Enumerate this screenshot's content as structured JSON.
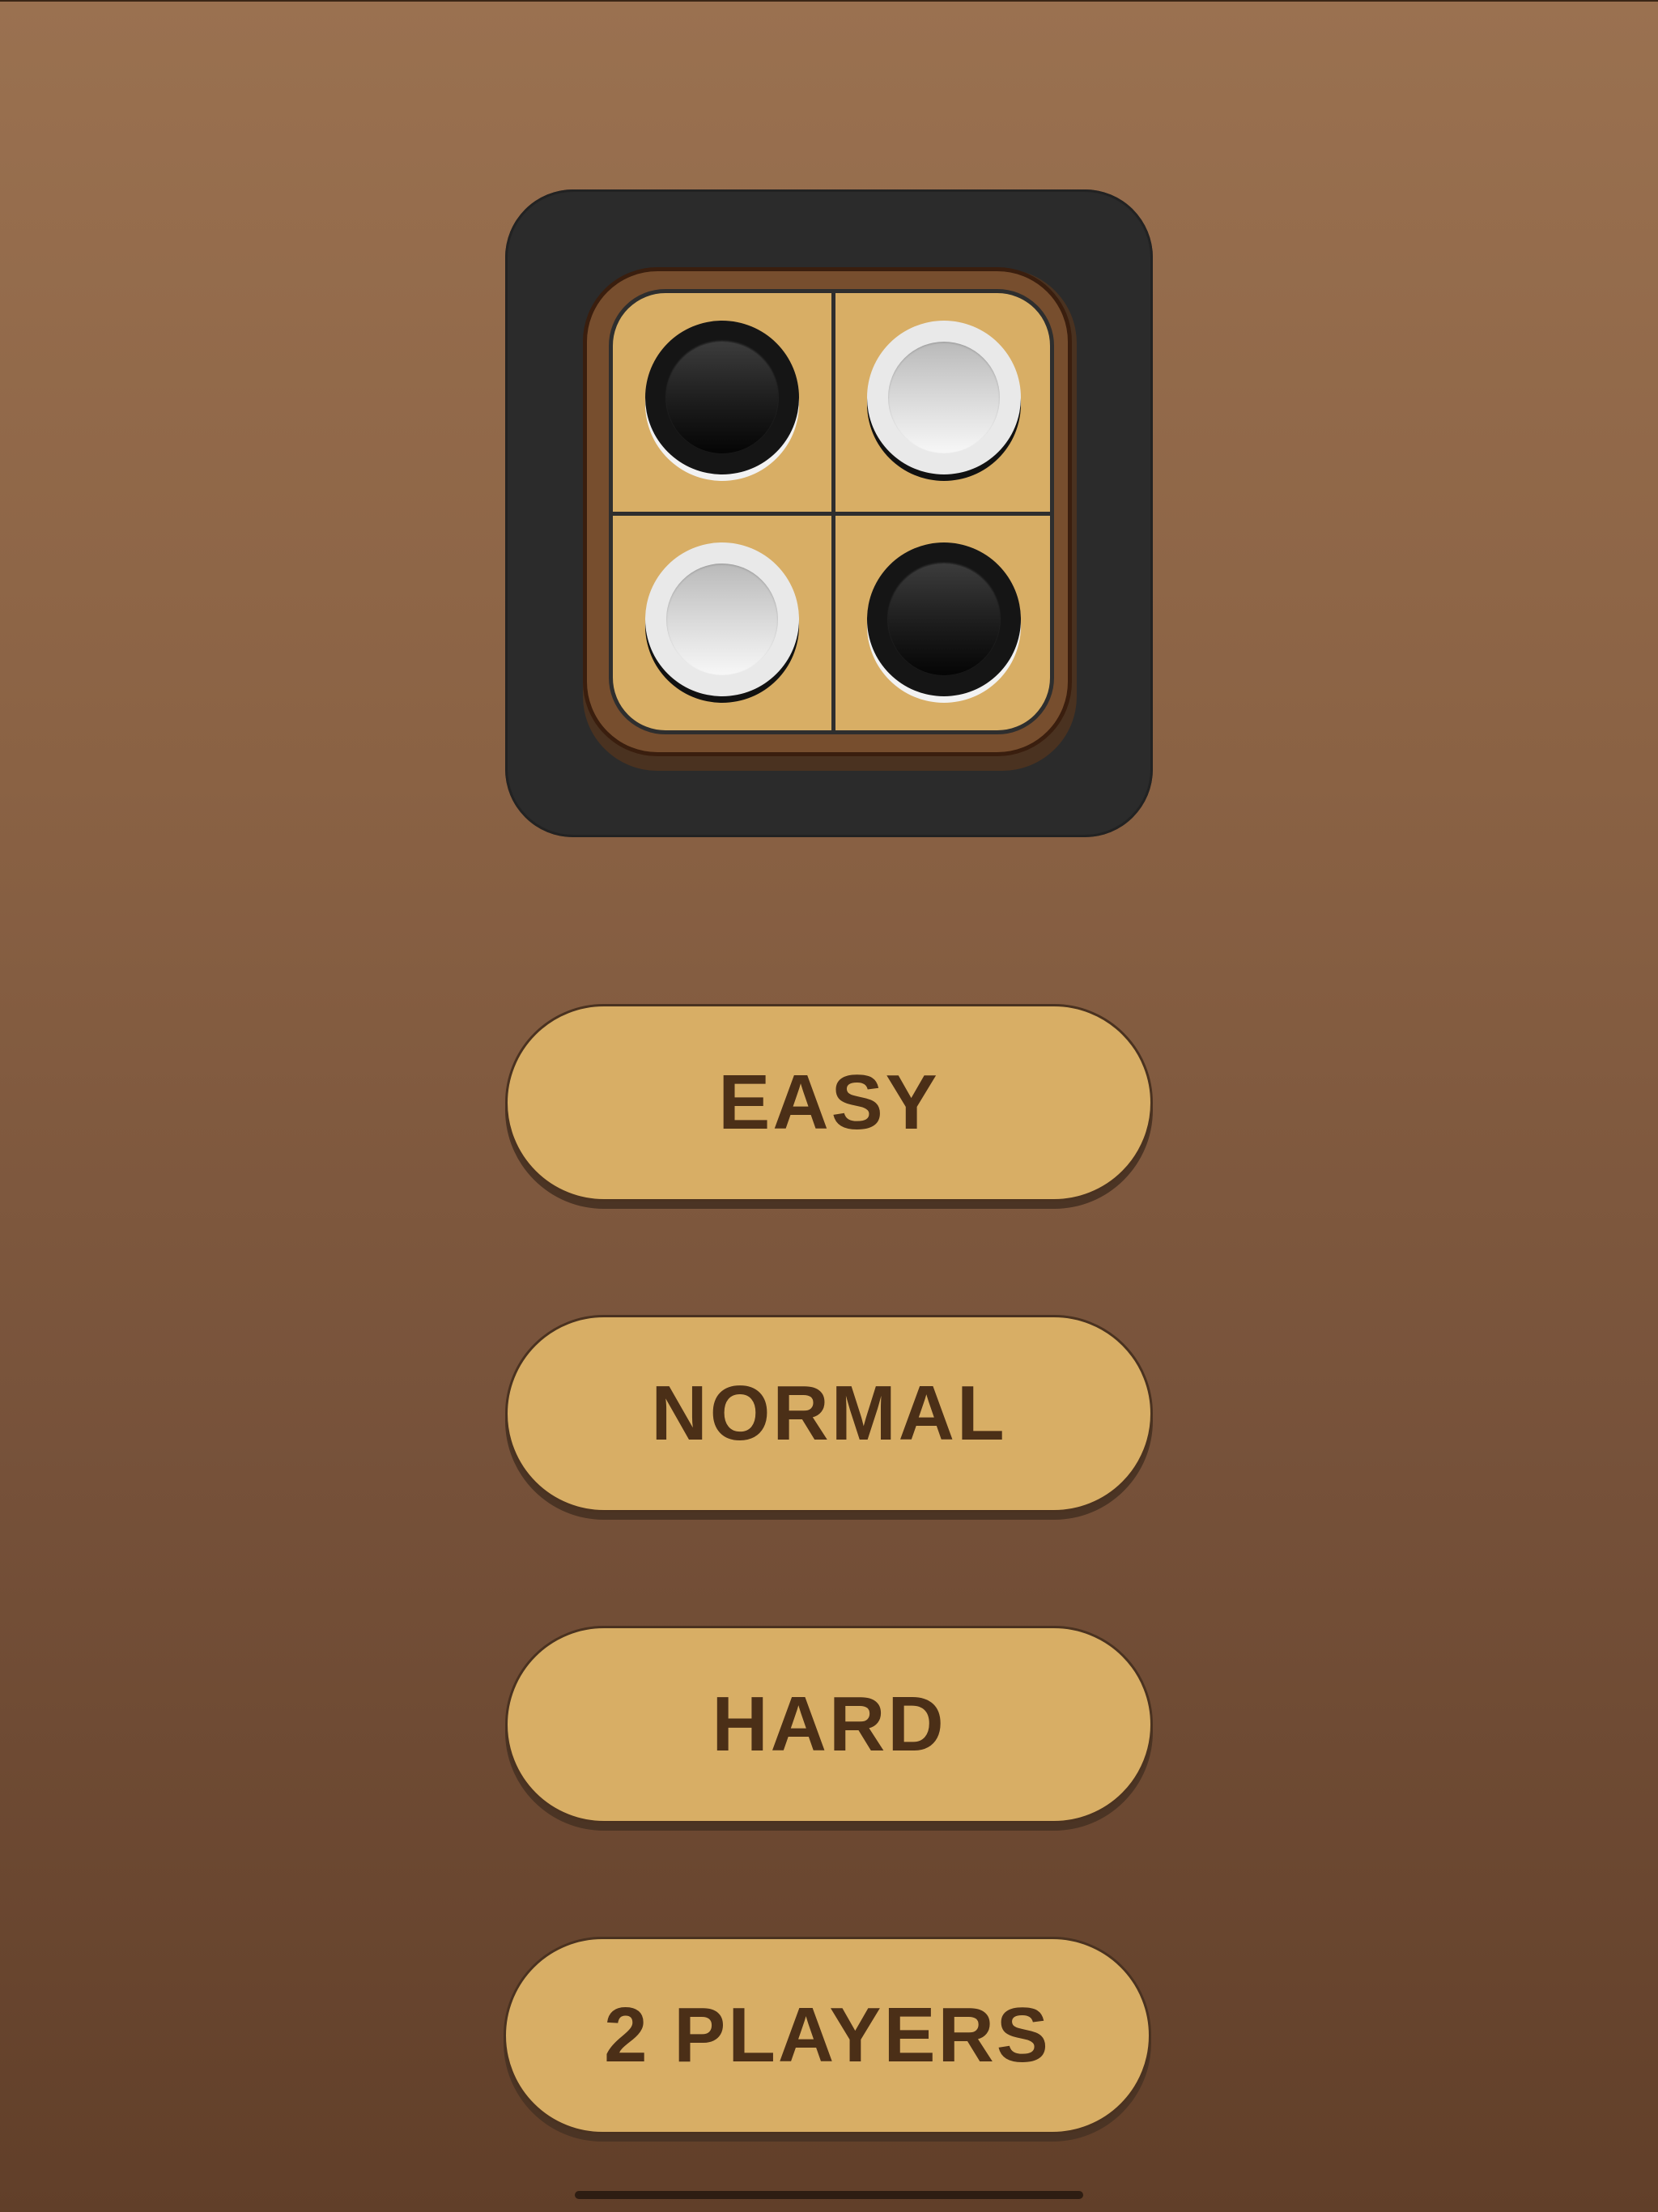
{
  "logo": {
    "icon": "reversi-board-icon",
    "board": [
      [
        "black",
        "white"
      ],
      [
        "white",
        "black"
      ]
    ],
    "colors": {
      "background": "#2b2b2b",
      "board": "#d8ae65",
      "frame": "#774e2e"
    }
  },
  "menu": {
    "easy_label": "EASY",
    "normal_label": "NORMAL",
    "hard_label": "HARD",
    "two_players_label": "2 PLAYERS"
  },
  "theme": {
    "button_color": "#d8ae65",
    "button_text_color": "#4b2f17",
    "background_top": "#9a7150",
    "background_bottom": "#613f29"
  }
}
